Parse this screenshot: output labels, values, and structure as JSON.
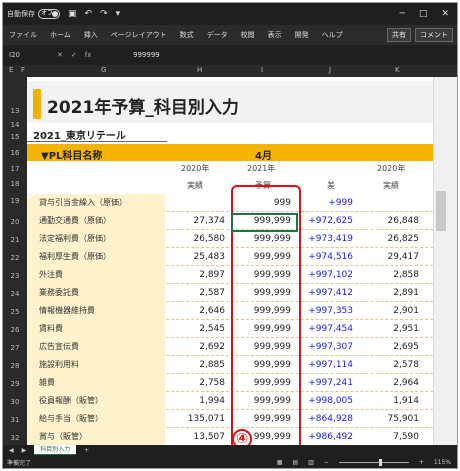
{
  "titlebar": {
    "autosave_label": "自動保存",
    "autosave_state": "オフ",
    "minimize": "─",
    "maximize": "□",
    "close": "✕"
  },
  "ribbon": {
    "tabs": [
      "ファイル",
      "ホーム",
      "挿入",
      "ページレイアウト",
      "数式",
      "データ",
      "校閲",
      "表示",
      "開発",
      "ヘルプ"
    ],
    "share": "共有",
    "comments": "コメント"
  },
  "formula": {
    "namebox": "I20",
    "value": "999999"
  },
  "columns": [
    "E",
    "F",
    "G",
    "H",
    "I",
    "J",
    "K"
  ],
  "rows": [
    "13",
    "14",
    "15",
    "16",
    "17",
    "18",
    "19",
    "20",
    "21",
    "22",
    "23",
    "24",
    "25",
    "26",
    "27",
    "28",
    "29",
    "30",
    "31",
    "32",
    "33"
  ],
  "sheet": {
    "title": "2021年予算_科目別入力",
    "company": "2021_東京リテール",
    "header_label": "▼PL科目名称",
    "month": "4月",
    "sub1": {
      "h": "2020年",
      "i": "2021年",
      "k": "2020年"
    },
    "sub2": {
      "h": "実績",
      "i": "予算",
      "j": "差",
      "k": "実績"
    }
  },
  "table": [
    {
      "name": "貸与引当金繰入（原価）",
      "h": "",
      "i": "999",
      "j": "+999",
      "k": ""
    },
    {
      "name": "通勤交通費（原価）",
      "h": "27,374",
      "i": "999,999",
      "j": "+972,625",
      "k": "26,848"
    },
    {
      "name": "法定福利費（原価）",
      "h": "26,580",
      "i": "999,999",
      "j": "+973,419",
      "k": "26,825"
    },
    {
      "name": "福利厚生費（原価）",
      "h": "25,483",
      "i": "999,999",
      "j": "+974,516",
      "k": "29,417"
    },
    {
      "name": "外注費",
      "h": "2,897",
      "i": "999,999",
      "j": "+997,102",
      "k": "2,858"
    },
    {
      "name": "業務委託費",
      "h": "2,587",
      "i": "999,999",
      "j": "+997,412",
      "k": "2,891"
    },
    {
      "name": "情報機器維持費",
      "h": "2,646",
      "i": "999,999",
      "j": "+997,353",
      "k": "2,901"
    },
    {
      "name": "賃料費",
      "h": "2,545",
      "i": "999,999",
      "j": "+997,454",
      "k": "2,951"
    },
    {
      "name": "広告宣伝費",
      "h": "2,692",
      "i": "999,999",
      "j": "+997,307",
      "k": "2,695"
    },
    {
      "name": "施設利用料",
      "h": "2,885",
      "i": "999,999",
      "j": "+997,114",
      "k": "2,578"
    },
    {
      "name": "雑費",
      "h": "2,758",
      "i": "999,999",
      "j": "+997,241",
      "k": "2,964"
    },
    {
      "name": "役員報酬（販管）",
      "h": "1,994",
      "i": "999,999",
      "j": "+998,005",
      "k": "1,914"
    },
    {
      "name": "給与手当（販管）",
      "h": "135,071",
      "i": "999,999",
      "j": "+864,928",
      "k": "75,901"
    },
    {
      "name": "賞与（販管）",
      "h": "13,507",
      "i": "999,999",
      "j": "+986,492",
      "k": "7,590"
    },
    {
      "name": "賞与引当金繰入（販管）",
      "h": "2,730",
      "i": "999,999",
      "j": "+997,269",
      "k": "2,548"
    }
  ],
  "annotation": {
    "marker": "④"
  },
  "sheettab": {
    "name": "科目別入力",
    "add": "+"
  },
  "status": {
    "ready": "準備完了",
    "zoom": "115%"
  }
}
